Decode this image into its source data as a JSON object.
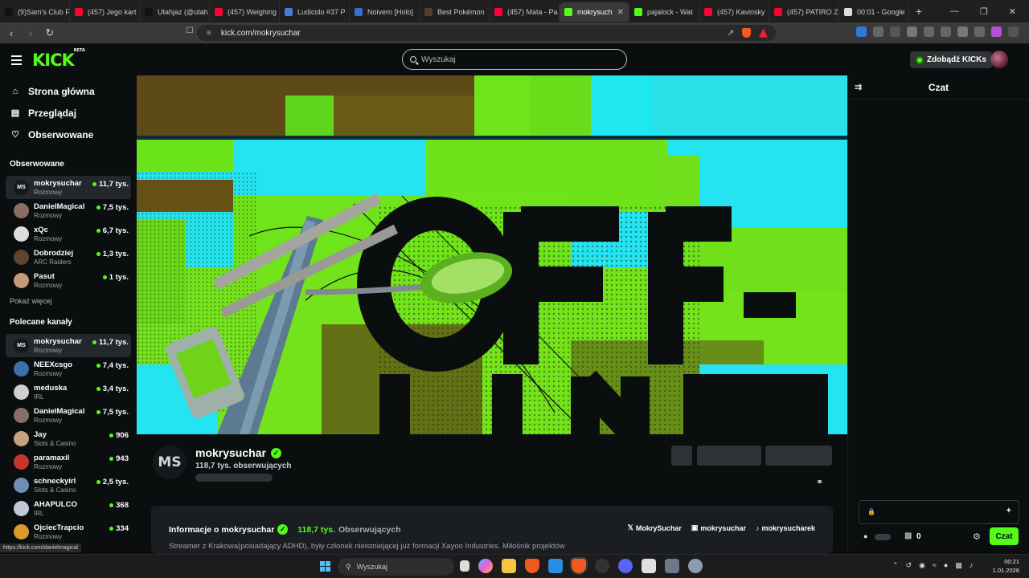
{
  "browser": {
    "tabs": [
      {
        "label": "(9)Sam's Club F",
        "color": "#111111"
      },
      {
        "label": "(457) Jego kart",
        "color": "#ff0033"
      },
      {
        "label": "Utahjaz (@utah",
        "color": "#111111"
      },
      {
        "label": "(457) Weighing",
        "color": "#ff0033"
      },
      {
        "label": "Ludicolo #37 P",
        "color": "#4a7bd6"
      },
      {
        "label": "Noivern [Holo]",
        "color": "#3a6bd0"
      },
      {
        "label": "Best Pokémon",
        "color": "#5a3b2b"
      },
      {
        "label": "(457) Mata - Pa",
        "color": "#ff0033"
      },
      {
        "label": "mokrysuch",
        "color": "#53fc18",
        "active": true
      },
      {
        "label": "pajalock - Wat",
        "color": "#53fc18"
      },
      {
        "label": "(457) Kavinsky",
        "color": "#ff0033"
      },
      {
        "label": "(457) PATIRO Z",
        "color": "#ff0033"
      },
      {
        "label": "00:01 - Google",
        "color": "#dddddd"
      }
    ],
    "url": "kick.com/mokrysuchar"
  },
  "header": {
    "logo": "KICK",
    "logo_beta": "BETA",
    "search_placeholder": "Wyszukaj",
    "get_kicks": "Zdobądź KICKs"
  },
  "sidebar": {
    "nav": [
      {
        "label": "Strona główna",
        "icon": "home-icon"
      },
      {
        "label": "Przeglądaj",
        "icon": "browse-icon"
      },
      {
        "label": "Obserwowane",
        "icon": "heart-icon"
      }
    ],
    "followed_title": "Obserwowane",
    "followed": [
      {
        "name": "mokrysuchar",
        "category": "Rozmowy",
        "viewers": "11,7 tys.",
        "avatar": "MS",
        "color": "#16191b",
        "active": true
      },
      {
        "name": "DanielMagical",
        "category": "Rozmowy",
        "viewers": "7,5 tys.",
        "avatar": "",
        "color": "#8a6e63"
      },
      {
        "name": "xQc",
        "category": "Rozmowy",
        "viewers": "6,7 tys.",
        "avatar": "",
        "color": "#dcdcdc"
      },
      {
        "name": "Dobrodziej",
        "category": "ARC Raiders",
        "viewers": "1,3 tys.",
        "avatar": "",
        "color": "#5c4632"
      },
      {
        "name": "Pasut",
        "category": "Rozmowy",
        "viewers": "1 tys.",
        "avatar": "",
        "color": "#c79a76"
      }
    ],
    "show_more": "Pokaż więcej",
    "recommended_title": "Polecane kanały",
    "recommended": [
      {
        "name": "mokrysuchar",
        "category": "Rozmowy",
        "viewers": "11,7 tys.",
        "avatar": "MS",
        "color": "#16191b",
        "active": true
      },
      {
        "name": "NEEXcsgo",
        "category": "Rozmowy",
        "viewers": "7,4 tys.",
        "avatar": "",
        "color": "#3d6fa8"
      },
      {
        "name": "meduska",
        "category": "IRL",
        "viewers": "3,4 tys.",
        "avatar": "",
        "color": "#cfcfcf"
      },
      {
        "name": "DanielMagical",
        "category": "Rozmowy",
        "viewers": "7,5 tys.",
        "avatar": "",
        "color": "#8a6e63"
      },
      {
        "name": "Jay",
        "category": "Slots & Casino",
        "viewers": "906",
        "avatar": "",
        "color": "#c6a27a"
      },
      {
        "name": "paramaxil",
        "category": "Rozmowy",
        "viewers": "943",
        "avatar": "",
        "color": "#c8342c"
      },
      {
        "name": "schneckyirl",
        "category": "Slots & Casino",
        "viewers": "2,5 tys.",
        "avatar": "",
        "color": "#6d8fb6"
      },
      {
        "name": "AHAPULCO",
        "category": "IRL",
        "viewers": "368",
        "avatar": "",
        "color": "#c2c9d6"
      },
      {
        "name": "OjciecTrapcio",
        "category": "Rozmowy",
        "viewers": "334",
        "avatar": "",
        "color": "#d99a2b"
      }
    ]
  },
  "channel": {
    "avatar": "MS",
    "name": "mokrysuchar",
    "followers": "118,7 tys. obserwujących",
    "about_title": "Informacje o mokrysuchar",
    "about_followers": "118,7 tys.",
    "about_followers_label": "Obserwujących",
    "description": "Streamer z Krakowa(posiadający ADHD), były członek nieistniejącej już formacji Xayoo Industries. Miłośnik projektów",
    "socials": [
      {
        "icon": "x-icon",
        "label": "MokrySuchar"
      },
      {
        "icon": "instagram-icon",
        "label": "mokrysuchar"
      },
      {
        "icon": "tiktok-icon",
        "label": "mokrysucharek"
      }
    ]
  },
  "banner": {
    "text_line1": "OFF-",
    "text_line2": "LINE"
  },
  "chat": {
    "title": "Czat",
    "gift_count": "0",
    "send_label": "Czat"
  },
  "status_url": "https://kick.com/danielmagical",
  "taskbar": {
    "search_placeholder": "Wyszukaj",
    "time": "00:21",
    "date": "1.01.2026"
  },
  "colors": {
    "accent": "#53fc18",
    "background": "#0b0e0f"
  }
}
